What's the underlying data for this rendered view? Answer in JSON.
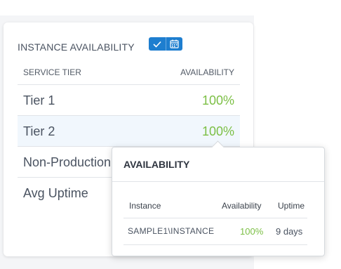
{
  "card": {
    "title": "INSTANCE AVAILABILITY",
    "toggle": {
      "selected_icon": "check-icon",
      "other_icon": "calendar-icon",
      "accent": "#1e7ecf"
    },
    "columns": [
      "SERVICE TIER",
      "AVAILABILITY"
    ],
    "rows": [
      {
        "name": "Tier 1",
        "value": "100%"
      },
      {
        "name": "Tier 2",
        "value": "100%"
      },
      {
        "name": "Non-Production",
        "value": ""
      },
      {
        "name": "Avg Uptime",
        "value": ""
      }
    ]
  },
  "tooltip": {
    "title": "AVAILABILITY",
    "columns": [
      "Instance",
      "Availability",
      "Uptime"
    ],
    "rows": [
      {
        "instance": "SAMPLE1\\INSTANCE",
        "availability": "100%",
        "uptime": "9 days"
      }
    ]
  },
  "colors": {
    "good": "#7cbf45",
    "text": "#4a5361",
    "highlight": "#f1f7fd"
  }
}
